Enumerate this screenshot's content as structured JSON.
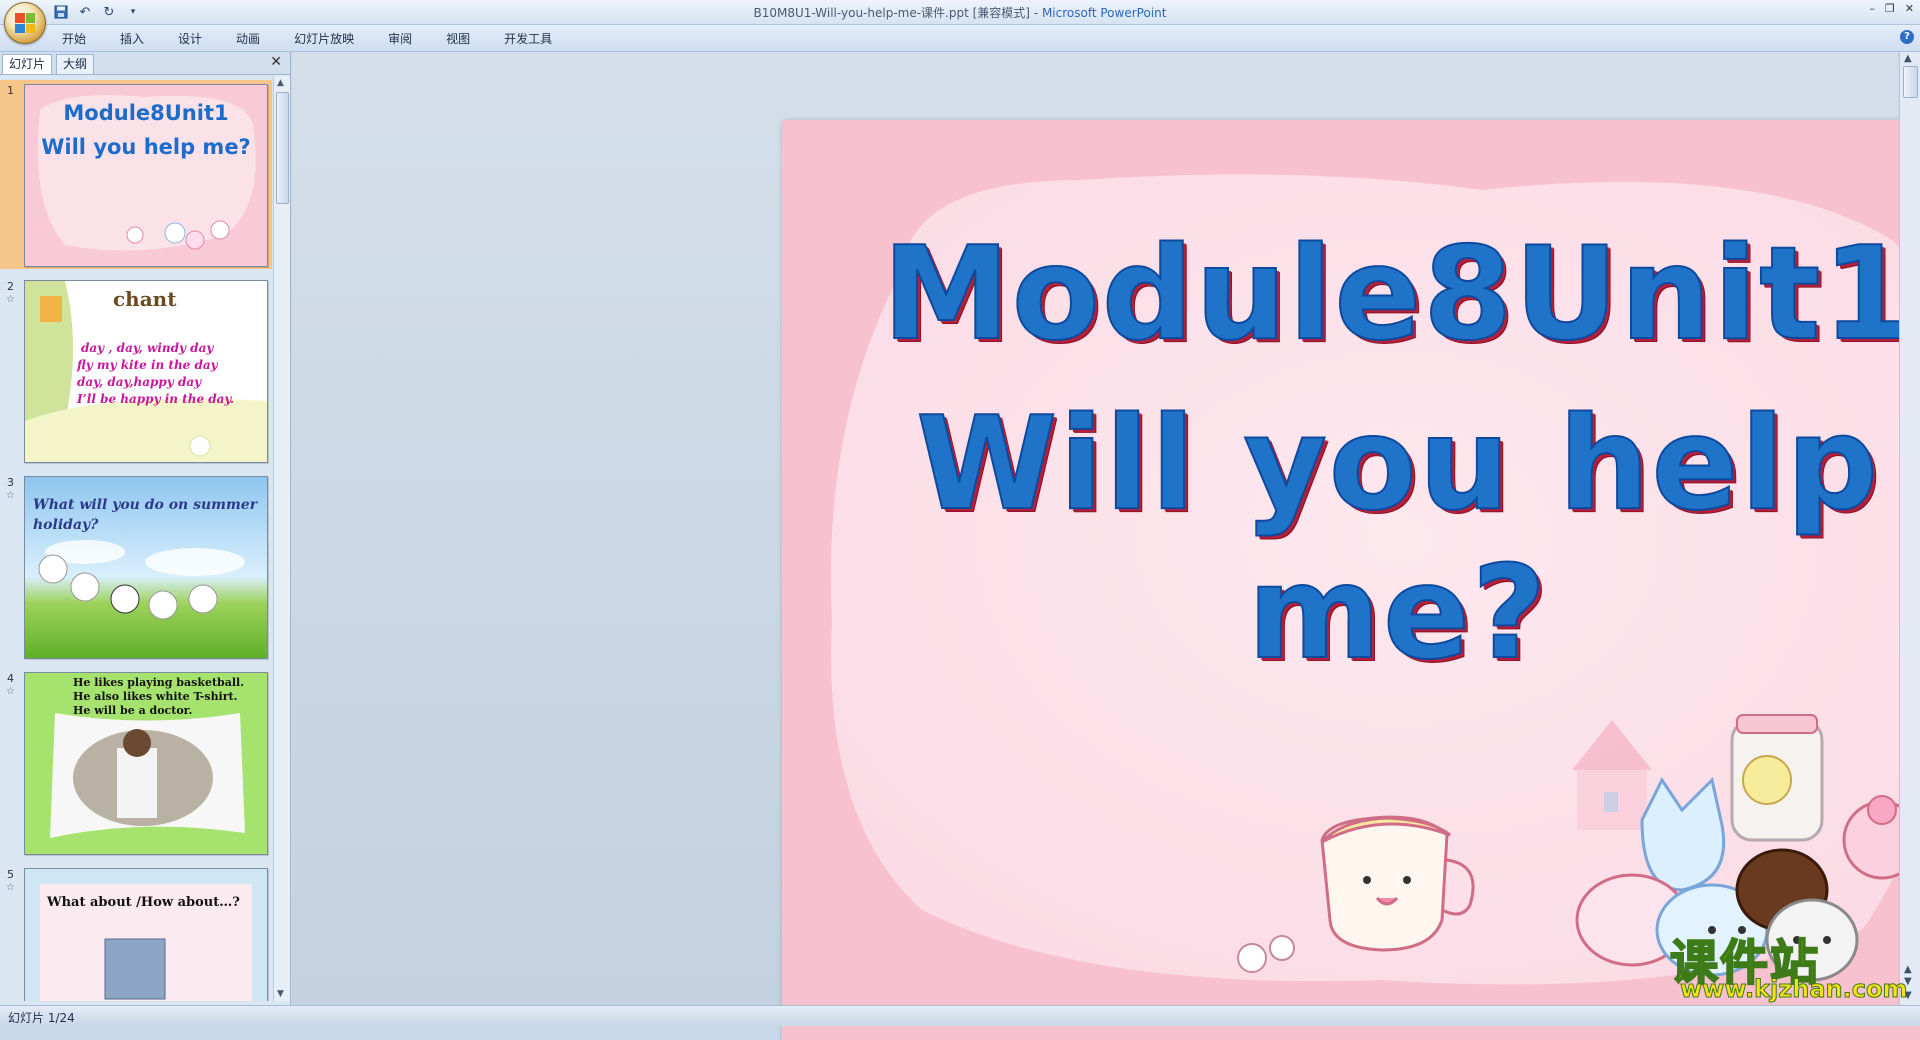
{
  "window": {
    "title_file": "B10M8U1-Will-you-help-me-课件.ppt [兼容模式] - ",
    "title_app": "Microsoft PowerPoint",
    "minimize": "–",
    "restore": "❐",
    "close": "✕"
  },
  "quick_access": {
    "save_icon": "save-icon",
    "undo_icon": "undo-icon",
    "redo_icon": "redo-icon"
  },
  "ribbon": {
    "tabs": [
      "开始",
      "插入",
      "设计",
      "动画",
      "幻灯片放映",
      "审阅",
      "视图",
      "开发工具"
    ],
    "help": "?"
  },
  "left_pane": {
    "tab_slides": "幻灯片",
    "tab_outline": "大纲",
    "close": "✕",
    "thumbnails": [
      {
        "num": "1",
        "line1": "Module8Unit1",
        "line2": "Will you help me?"
      },
      {
        "num": "2",
        "title": "chant",
        "lines": [
          "day , day, windy  day",
          "fly my kite in the day",
          "day, day,happy day",
          "I’ll be happy in the day."
        ]
      },
      {
        "num": "3",
        "lines": [
          "What will you do on summer",
          "holiday?"
        ]
      },
      {
        "num": "4",
        "lines": [
          "He likes playing basketball.",
          "He also likes white T-shirt.",
          "He will be a doctor."
        ]
      },
      {
        "num": "5",
        "lines": [
          "What about /How about…?"
        ]
      }
    ]
  },
  "slide": {
    "line1": "Module8Unit1",
    "line2": "Will you help me?"
  },
  "status": {
    "slide_counter": "幻灯片 1/24"
  },
  "watermark": {
    "text_cn": "课件站",
    "url": "www.kjzhan.com"
  },
  "colors": {
    "slide_bg": "#f7c1d0",
    "title_fill": "#1f73c8",
    "title_shadow": "#b51f3a",
    "selected_thumb": "#f6c58a"
  }
}
